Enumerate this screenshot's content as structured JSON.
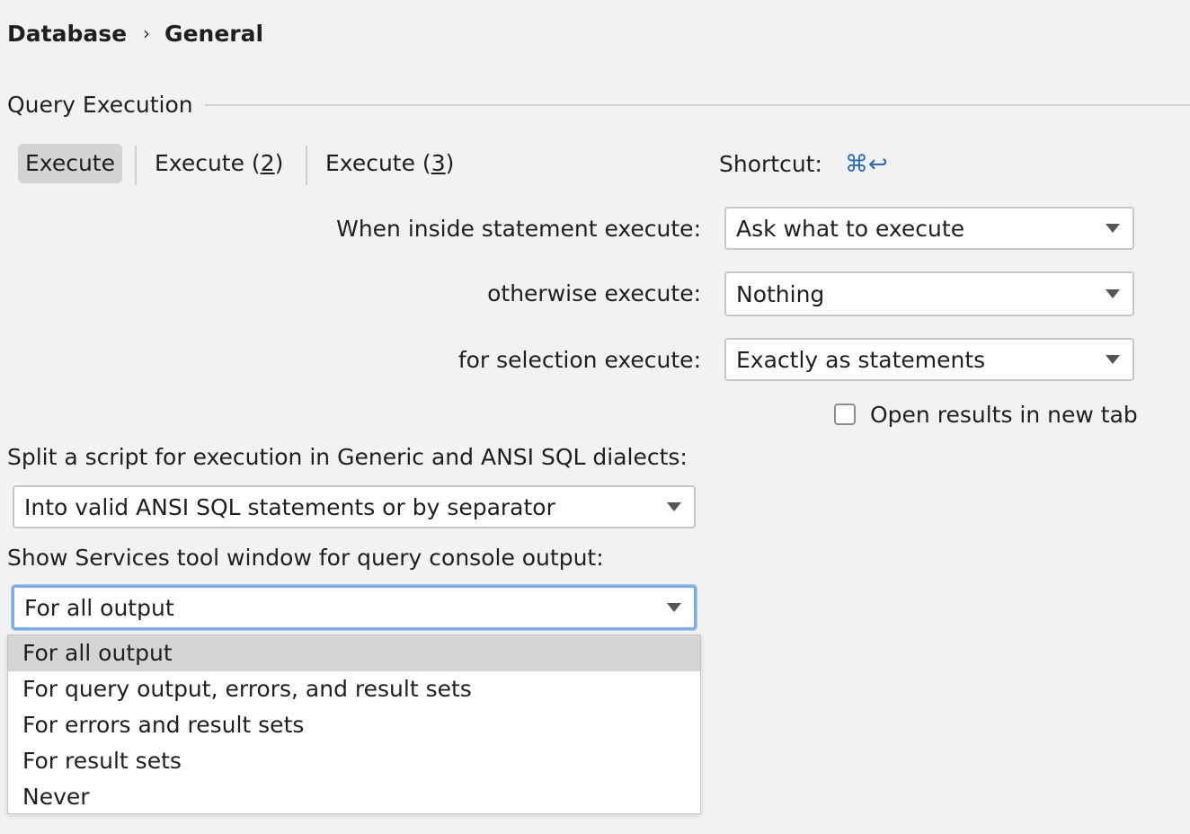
{
  "breadcrumb": {
    "parent": "Database",
    "separator": "›",
    "current": "General"
  },
  "group": {
    "title": "Query Execution"
  },
  "tabs": [
    {
      "prefix": "Execute",
      "mnemonic": "",
      "suffix": ""
    },
    {
      "prefix": "Execute (",
      "mnemonic": "2",
      "suffix": ")"
    },
    {
      "prefix": "Execute (",
      "mnemonic": "3",
      "suffix": ")"
    }
  ],
  "shortcut": {
    "label": "Shortcut:",
    "keys": "⌘↩"
  },
  "when_inside": {
    "label": "When inside statement execute:",
    "value": "Ask what to execute"
  },
  "otherwise": {
    "label": "otherwise execute:",
    "value": "Nothing"
  },
  "for_selection": {
    "label": "for selection execute:",
    "value": "Exactly as statements"
  },
  "open_results": {
    "label": "Open results in new tab",
    "checked": false
  },
  "split_script": {
    "label": "Split a script for execution in Generic and ANSI SQL dialects:",
    "value": "Into valid ANSI SQL statements or by separator"
  },
  "services_window": {
    "label": "Show Services tool window for query console output:",
    "value": "For all output",
    "options": [
      "For all output",
      "For query output, errors, and result sets",
      "For errors and result sets",
      "For result sets",
      "Never"
    ],
    "selected_option": "For all output"
  },
  "colors": {
    "accent": "#2b6cbf",
    "focus": "#7aaee8",
    "background": "#f2f2f2"
  }
}
